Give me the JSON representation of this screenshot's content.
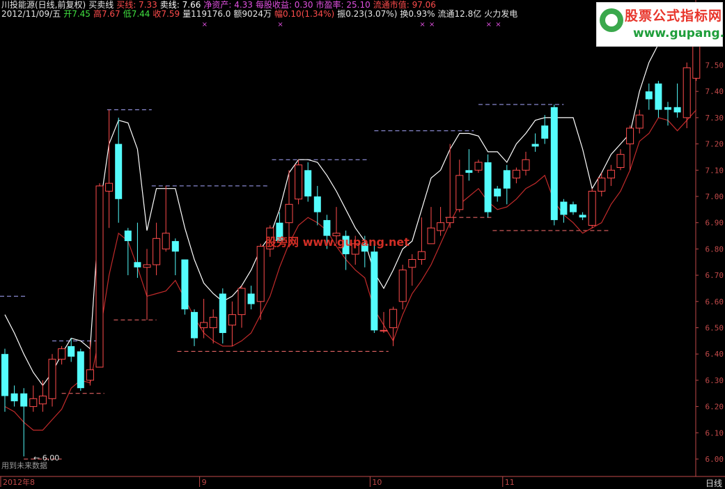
{
  "header": {
    "line1": [
      {
        "text": "川投能源(日线,前复权)",
        "color": "#e6e6e6"
      },
      {
        "text": "买卖线",
        "color": "#e6e6e6"
      },
      {
        "text": "买线: 7.33",
        "color": "#ff4c4c"
      },
      {
        "text": "卖线: 7.66",
        "color": "#ffffff"
      },
      {
        "text": "净资产: 4.33",
        "color": "#e050e0"
      },
      {
        "text": "每股收益: 0.30",
        "color": "#e050e0"
      },
      {
        "text": "市盈率: 25.10",
        "color": "#e050e0"
      },
      {
        "text": "流通市值: 97.06",
        "color": "#ff4c4c"
      }
    ],
    "line2": [
      {
        "text": "2012/11/09/五",
        "color": "#e6e6e6"
      },
      {
        "text": "开7.45",
        "color": "#40e040"
      },
      {
        "text": "高7.67",
        "color": "#ff4c4c"
      },
      {
        "text": "低7.44",
        "color": "#40e040"
      },
      {
        "text": "收7.59",
        "color": "#ff4c4c"
      },
      {
        "text": "量119176.0",
        "color": "#e6e6e6"
      },
      {
        "text": "额9024万",
        "color": "#e6e6e6"
      },
      {
        "text": "幅0.10(1.34%)",
        "color": "#ff4c4c"
      },
      {
        "text": "振0.23(3.07%)",
        "color": "#e6e6e6"
      },
      {
        "text": "换0.93%",
        "color": "#e6e6e6"
      },
      {
        "text": "流通12.8亿",
        "color": "#e6e6e6"
      },
      {
        "text": "火力发电",
        "color": "#e6e6e6"
      }
    ]
  },
  "logo": {
    "cn": "股票公式指标网",
    "url": "www.gupang.net"
  },
  "watermark": "股旁网 www.gupang.net",
  "footnote": "用到未来数据",
  "low_label": "← 6.00",
  "period_label": "日线",
  "x_labels": [
    {
      "text": "2012年8",
      "idx": 0
    },
    {
      "text": "9",
      "idx": 21
    },
    {
      "text": "10",
      "idx": 39
    },
    {
      "text": "11",
      "idx": 53
    }
  ],
  "colors": {
    "up": "#ff4c4c",
    "down": "#54fcfc",
    "buy_line": "#c22b2b",
    "sell_line": "#ffffff",
    "dash_sell": "#a8a8ff",
    "dash_buy": "#ff7070",
    "axis": "#c24a4a"
  },
  "chart_data": {
    "type": "candlestick",
    "ylim": [
      6.0,
      7.7
    ],
    "yticks": [
      6.0,
      6.1,
      6.2,
      6.3,
      6.4,
      6.5,
      6.6,
      6.7,
      6.8,
      6.9,
      7.0,
      7.1,
      7.2,
      7.3,
      7.4,
      7.5
    ],
    "candles": [
      {
        "o": 6.4,
        "h": 6.42,
        "l": 6.18,
        "c": 6.24
      },
      {
        "o": 6.25,
        "h": 6.28,
        "l": 6.2,
        "c": 6.22
      },
      {
        "o": 6.25,
        "h": 6.27,
        "l": 6.01,
        "c": 6.2
      },
      {
        "o": 6.2,
        "h": 6.28,
        "l": 6.18,
        "c": 6.23
      },
      {
        "o": 6.21,
        "h": 6.3,
        "l": 6.18,
        "c": 6.24
      },
      {
        "o": 6.23,
        "h": 6.4,
        "l": 6.2,
        "c": 6.38
      },
      {
        "o": 6.38,
        "h": 6.43,
        "l": 6.36,
        "c": 6.42
      },
      {
        "o": 6.43,
        "h": 6.46,
        "l": 6.37,
        "c": 6.39
      },
      {
        "o": 6.41,
        "h": 6.42,
        "l": 6.26,
        "c": 6.27
      },
      {
        "o": 6.3,
        "h": 6.45,
        "l": 6.28,
        "c": 6.34
      },
      {
        "o": 6.35,
        "h": 7.05,
        "l": 6.35,
        "c": 7.04
      },
      {
        "o": 7.02,
        "h": 7.33,
        "l": 6.88,
        "c": 7.05
      },
      {
        "o": 7.2,
        "h": 7.3,
        "l": 6.9,
        "c": 6.99
      },
      {
        "o": 6.87,
        "h": 6.88,
        "l": 6.7,
        "c": 6.83
      },
      {
        "o": 6.75,
        "h": 6.9,
        "l": 6.69,
        "c": 6.73
      },
      {
        "o": 6.73,
        "h": 6.8,
        "l": 6.53,
        "c": 6.74
      },
      {
        "o": 6.74,
        "h": 6.9,
        "l": 6.7,
        "c": 6.84
      },
      {
        "o": 6.8,
        "h": 7.04,
        "l": 6.79,
        "c": 6.86
      },
      {
        "o": 6.83,
        "h": 6.84,
        "l": 6.7,
        "c": 6.79
      },
      {
        "o": 6.76,
        "h": 6.76,
        "l": 6.55,
        "c": 6.57
      },
      {
        "o": 6.56,
        "h": 6.57,
        "l": 6.43,
        "c": 6.46
      },
      {
        "o": 6.5,
        "h": 6.61,
        "l": 6.46,
        "c": 6.52
      },
      {
        "o": 6.5,
        "h": 6.57,
        "l": 6.44,
        "c": 6.54
      },
      {
        "o": 6.63,
        "h": 6.65,
        "l": 6.44,
        "c": 6.48
      },
      {
        "o": 6.51,
        "h": 6.6,
        "l": 6.43,
        "c": 6.55
      },
      {
        "o": 6.55,
        "h": 6.66,
        "l": 6.5,
        "c": 6.65
      },
      {
        "o": 6.63,
        "h": 6.66,
        "l": 6.57,
        "c": 6.59
      },
      {
        "o": 6.6,
        "h": 6.82,
        "l": 6.53,
        "c": 6.81
      },
      {
        "o": 6.8,
        "h": 6.89,
        "l": 6.77,
        "c": 6.88
      },
      {
        "o": 6.9,
        "h": 6.94,
        "l": 6.83,
        "c": 6.83
      },
      {
        "o": 6.9,
        "h": 7.1,
        "l": 6.84,
        "c": 6.97
      },
      {
        "o": 6.99,
        "h": 7.14,
        "l": 6.97,
        "c": 7.12
      },
      {
        "o": 7.1,
        "h": 7.13,
        "l": 6.98,
        "c": 7.0
      },
      {
        "o": 7.0,
        "h": 7.04,
        "l": 6.89,
        "c": 6.94
      },
      {
        "o": 6.91,
        "h": 6.93,
        "l": 6.8,
        "c": 6.85
      },
      {
        "o": 6.85,
        "h": 6.96,
        "l": 6.82,
        "c": 6.86
      },
      {
        "o": 6.85,
        "h": 6.87,
        "l": 6.72,
        "c": 6.78
      },
      {
        "o": 6.78,
        "h": 6.85,
        "l": 6.74,
        "c": 6.82
      },
      {
        "o": 6.82,
        "h": 6.85,
        "l": 6.73,
        "c": 6.79
      },
      {
        "o": 6.79,
        "h": 6.82,
        "l": 6.48,
        "c": 6.49
      },
      {
        "o": 6.49,
        "h": 6.56,
        "l": 6.48,
        "c": 6.49
      },
      {
        "o": 6.5,
        "h": 6.58,
        "l": 6.43,
        "c": 6.57
      },
      {
        "o": 6.6,
        "h": 6.74,
        "l": 6.57,
        "c": 6.72
      },
      {
        "o": 6.73,
        "h": 6.78,
        "l": 6.66,
        "c": 6.76
      },
      {
        "o": 6.76,
        "h": 6.92,
        "l": 6.74,
        "c": 6.79
      },
      {
        "o": 6.82,
        "h": 6.96,
        "l": 6.82,
        "c": 6.88
      },
      {
        "o": 6.87,
        "h": 6.96,
        "l": 6.85,
        "c": 6.9
      },
      {
        "o": 6.9,
        "h": 7.2,
        "l": 6.88,
        "c": 6.92
      },
      {
        "o": 6.95,
        "h": 7.14,
        "l": 6.94,
        "c": 7.08
      },
      {
        "o": 7.1,
        "h": 7.18,
        "l": 7.06,
        "c": 7.09
      },
      {
        "o": 7.1,
        "h": 7.14,
        "l": 7.09,
        "c": 7.13
      },
      {
        "o": 7.13,
        "h": 7.16,
        "l": 6.92,
        "c": 6.94
      },
      {
        "o": 7.03,
        "h": 7.04,
        "l": 6.98,
        "c": 7.0
      },
      {
        "o": 7.1,
        "h": 7.12,
        "l": 6.97,
        "c": 7.03
      },
      {
        "o": 7.07,
        "h": 7.11,
        "l": 7.05,
        "c": 7.1
      },
      {
        "o": 7.1,
        "h": 7.17,
        "l": 7.08,
        "c": 7.14
      },
      {
        "o": 7.2,
        "h": 7.24,
        "l": 7.17,
        "c": 7.19
      },
      {
        "o": 7.27,
        "h": 7.31,
        "l": 7.2,
        "c": 7.22
      },
      {
        "o": 7.34,
        "h": 7.35,
        "l": 6.89,
        "c": 6.91
      },
      {
        "o": 6.98,
        "h": 6.99,
        "l": 6.9,
        "c": 6.93
      },
      {
        "o": 6.97,
        "h": 6.98,
        "l": 6.93,
        "c": 6.94
      },
      {
        "o": 6.93,
        "h": 6.94,
        "l": 6.91,
        "c": 6.92
      },
      {
        "o": 6.89,
        "h": 7.03,
        "l": 6.88,
        "c": 7.02
      },
      {
        "o": 7.02,
        "h": 7.09,
        "l": 7.0,
        "c": 7.07
      },
      {
        "o": 7.07,
        "h": 7.12,
        "l": 7.04,
        "c": 7.1
      },
      {
        "o": 7.11,
        "h": 7.18,
        "l": 7.1,
        "c": 7.16
      },
      {
        "o": 7.2,
        "h": 7.27,
        "l": 7.1,
        "c": 7.26
      },
      {
        "o": 7.26,
        "h": 7.33,
        "l": 7.24,
        "c": 7.31
      },
      {
        "o": 7.4,
        "h": 7.43,
        "l": 7.33,
        "c": 7.37
      },
      {
        "o": 7.43,
        "h": 7.44,
        "l": 7.3,
        "c": 7.33
      },
      {
        "o": 7.34,
        "h": 7.36,
        "l": 7.27,
        "c": 7.33
      },
      {
        "o": 7.34,
        "h": 7.43,
        "l": 7.3,
        "c": 7.32
      },
      {
        "o": 7.3,
        "h": 7.51,
        "l": 7.26,
        "c": 7.49
      },
      {
        "o": 7.45,
        "h": 7.67,
        "l": 7.44,
        "c": 7.59
      }
    ],
    "sell_line": [
      6.55,
      6.48,
      6.4,
      6.33,
      6.28,
      6.33,
      6.4,
      6.46,
      6.45,
      6.42,
      6.95,
      7.2,
      7.29,
      7.28,
      7.18,
      6.87,
      7.03,
      7.03,
      7.03,
      6.88,
      6.76,
      6.67,
      6.63,
      6.6,
      6.62,
      6.66,
      6.72,
      6.8,
      6.85,
      6.95,
      7.09,
      7.14,
      7.14,
      7.13,
      7.08,
      7.02,
      6.95,
      6.88,
      6.83,
      6.71,
      6.65,
      6.72,
      6.8,
      6.83,
      6.95,
      7.07,
      7.1,
      7.18,
      7.24,
      7.24,
      7.23,
      7.17,
      7.17,
      7.13,
      7.2,
      7.24,
      7.29,
      7.3,
      7.3,
      7.3,
      7.3,
      7.18,
      7.03,
      7.09,
      7.16,
      7.2,
      7.24,
      7.4,
      7.51,
      7.58,
      7.58,
      7.58,
      7.6,
      7.68
    ],
    "buy_line": [
      6.2,
      6.18,
      6.14,
      6.11,
      6.11,
      6.15,
      6.19,
      6.27,
      6.3,
      6.29,
      6.47,
      6.7,
      6.86,
      6.83,
      6.73,
      6.62,
      6.63,
      6.64,
      6.68,
      6.61,
      6.54,
      6.48,
      6.45,
      6.43,
      6.43,
      6.45,
      6.48,
      6.55,
      6.62,
      6.73,
      6.82,
      6.89,
      6.92,
      6.9,
      6.87,
      6.81,
      6.76,
      6.72,
      6.69,
      6.57,
      6.51,
      6.45,
      6.55,
      6.63,
      6.68,
      6.74,
      6.82,
      6.9,
      6.97,
      7.0,
      7.03,
      6.98,
      6.95,
      6.96,
      6.99,
      7.03,
      7.05,
      7.08,
      6.98,
      6.93,
      6.9,
      6.86,
      6.88,
      6.9,
      6.97,
      7.02,
      7.1,
      7.21,
      7.24,
      7.3,
      7.29,
      7.25,
      7.29,
      7.33
    ],
    "sell_dashes": [
      {
        "y": 6.62,
        "i0": -1,
        "i1": 2.2
      },
      {
        "y": 6.45,
        "i0": 5,
        "i1": 10
      },
      {
        "y": 7.33,
        "i0": 10.8,
        "i1": 15.5
      },
      {
        "y": 7.04,
        "i0": 15.5,
        "i1": 28
      },
      {
        "y": 7.14,
        "i0": 28.2,
        "i1": 38.5
      },
      {
        "y": 7.25,
        "i0": 39,
        "i1": 49.5
      },
      {
        "y": 7.35,
        "i0": 50,
        "i1": 59
      }
    ],
    "buy_dashes": [
      {
        "y": 6.0,
        "i0": 2,
        "i1": 6
      },
      {
        "y": 6.25,
        "i0": 6,
        "i1": 10.5
      },
      {
        "y": 6.53,
        "i0": 11.5,
        "i1": 16
      },
      {
        "y": 6.41,
        "i0": 18.2,
        "i1": 40.5
      },
      {
        "y": 6.92,
        "i0": 46.5,
        "i1": 51.5
      },
      {
        "y": 6.87,
        "i0": 51.5,
        "i1": 64
      }
    ],
    "markers": [
      21,
      29,
      44,
      45,
      51,
      52
    ]
  }
}
